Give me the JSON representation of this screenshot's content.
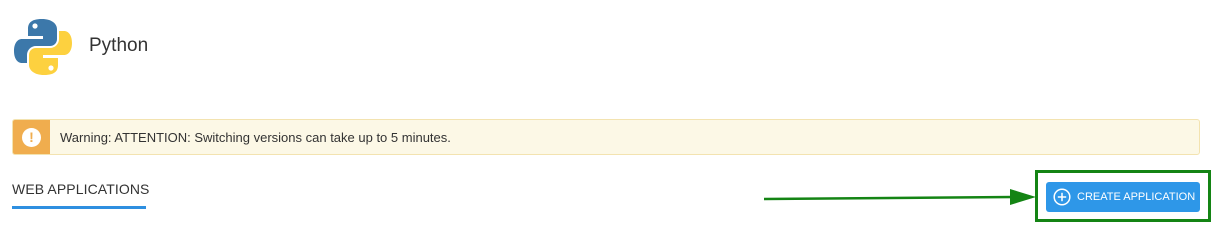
{
  "header": {
    "app_icon": "python-logo-icon",
    "title": "Python"
  },
  "warning": {
    "icon": "exclamation-icon",
    "text": "Warning: ATTENTION: Switching versions can take up to 5 minutes."
  },
  "tabs": [
    {
      "label": "WEB APPLICATIONS",
      "active": true
    }
  ],
  "actions": {
    "create_label": "CREATE APPLICATION",
    "create_icon": "plus-circle-icon"
  },
  "annotation": {
    "arrow_icon": "arrow-right-icon",
    "highlight_color": "#148414"
  },
  "colors": {
    "accent": "#2e97e8",
    "warning_accent": "#f0ad4e",
    "warning_background": "#fcf8e6",
    "annotation_green": "#148414"
  }
}
